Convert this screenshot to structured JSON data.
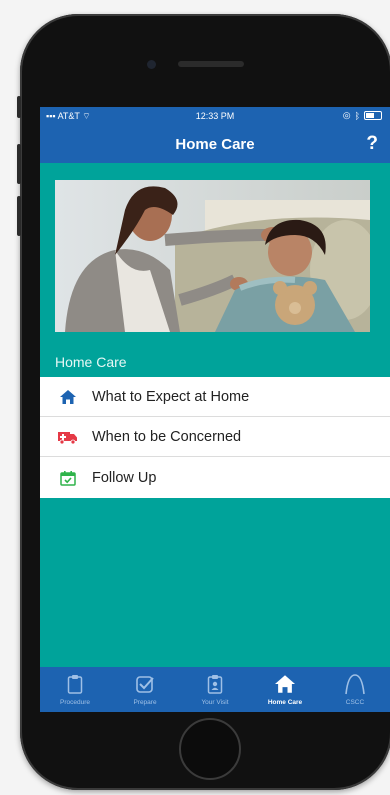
{
  "status_bar": {
    "carrier": "AT&T",
    "time": "12:33 PM"
  },
  "nav": {
    "title": "Home Care",
    "help_label": "?"
  },
  "hero": {
    "alt": "Mother checking child's temperature"
  },
  "section_label": "Home Care",
  "menu": [
    {
      "label": "What to Expect at Home",
      "icon": "home-icon",
      "color": "#1d63b1"
    },
    {
      "label": "When to be Concerned",
      "icon": "ambulance-icon",
      "color": "#e53946"
    },
    {
      "label": "Follow Up",
      "icon": "calendar-check-icon",
      "color": "#2fb34a"
    }
  ],
  "tabs": [
    {
      "label": "Procedure",
      "icon": "clipboard-icon",
      "active": false
    },
    {
      "label": "Prepare",
      "icon": "checkbox-icon",
      "active": false
    },
    {
      "label": "Your Visit",
      "icon": "clipboard-person-icon",
      "active": false
    },
    {
      "label": "Home Care",
      "icon": "home-icon",
      "active": true
    },
    {
      "label": "CSCC",
      "icon": "arch-logo-icon",
      "active": false
    }
  ],
  "colors": {
    "brand_blue": "#1d63b1",
    "teal": "#00a39a"
  }
}
